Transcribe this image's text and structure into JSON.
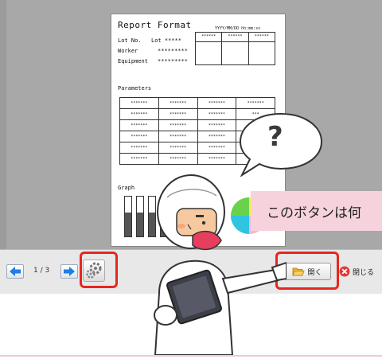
{
  "document": {
    "title": "Report Format",
    "lot_label": "Lot No.",
    "lot_value": "Lot *****",
    "worker_label": "Worker",
    "worker_value": "*********",
    "equipment_label": "Equipment",
    "equipment_value": "*********",
    "datetime": "YYYY/MM/DD hh:mm:ss",
    "stamp_headers": [
      "******",
      "******",
      "******"
    ],
    "parameters_label": "Parameters",
    "parameter_rows": [
      [
        "*******",
        "*******",
        "*******",
        "*******"
      ],
      [
        "*******",
        "*******",
        "*******",
        "***"
      ],
      [
        "*******",
        "*******",
        "*******",
        ""
      ],
      [
        "*******",
        "*******",
        "*******",
        ""
      ],
      [
        "*******",
        "*******",
        "*******",
        ""
      ],
      [
        "*******",
        "*******",
        "*******",
        ""
      ]
    ],
    "graph_label": "Graph",
    "bar_levels": [
      0.6,
      0.6,
      0.6,
      0.6,
      0.6
    ]
  },
  "toolbar": {
    "page_indicator": "1 / 3",
    "open_label": "開く",
    "close_label": "閉じる"
  },
  "overlay": {
    "question_mark": "?",
    "hint_text": "このボタンは何"
  },
  "colors": {
    "highlight": "#e8261f",
    "hint_bg": "#f6d3dc",
    "viewer_bg": "#a8a8a8"
  }
}
